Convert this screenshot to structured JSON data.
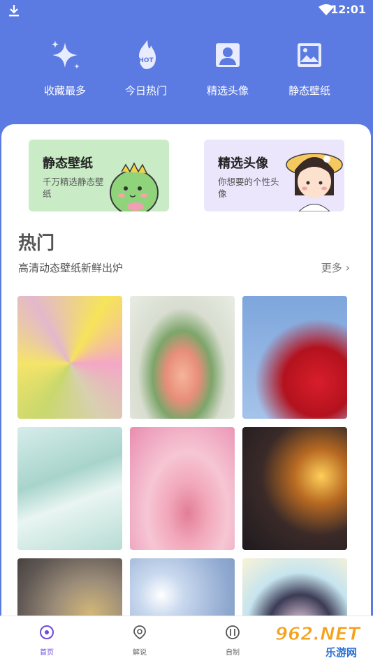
{
  "status": {
    "time": "12:01"
  },
  "top_nav": [
    {
      "label": "收藏最多",
      "icon": "sparkle-icon"
    },
    {
      "label": "今日热门",
      "icon": "hot-flame-icon",
      "icon_text": "HOT"
    },
    {
      "label": "精选头像",
      "icon": "avatar-icon"
    },
    {
      "label": "静态壁纸",
      "icon": "image-icon"
    }
  ],
  "cards": [
    {
      "title": "静态壁纸",
      "desc": "千万精选静态壁纸"
    },
    {
      "title": "精选头像",
      "desc": "你想要的个性头像"
    }
  ],
  "hot": {
    "title": "热门",
    "subtitle": "高清动态壁纸新鲜出炉",
    "more": "更多"
  },
  "tabs": [
    {
      "label": "首页",
      "icon": "home-icon"
    },
    {
      "label": "解说",
      "icon": "explain-icon"
    },
    {
      "label": "自制",
      "icon": "diy-icon"
    }
  ],
  "watermark": {
    "text": "962.NET",
    "sub": "乐游网"
  },
  "colors": {
    "header": "#5b7be3",
    "accent": "#6d4bd9"
  }
}
